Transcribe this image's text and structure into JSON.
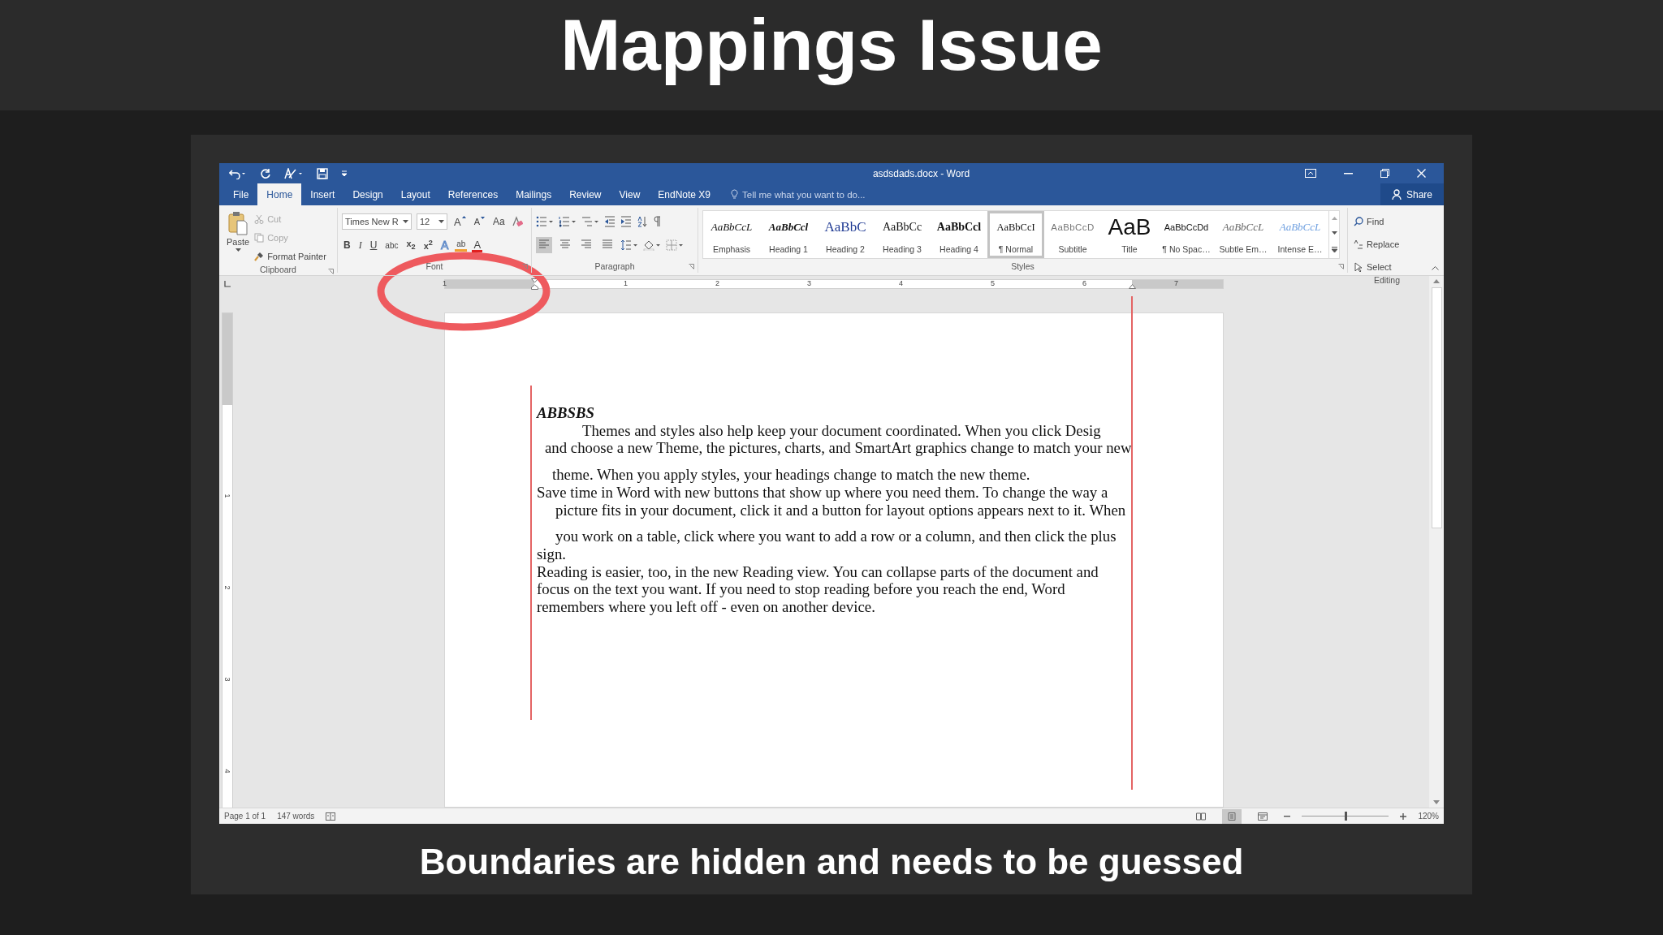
{
  "slide": {
    "title": "Mappings Issue",
    "caption": "Boundaries are hidden and needs to be guessed"
  },
  "window": {
    "title": "asdsdads.docx - Word"
  },
  "tabs": [
    {
      "label": "File",
      "selected": false
    },
    {
      "label": "Home",
      "selected": true
    },
    {
      "label": "Insert",
      "selected": false
    },
    {
      "label": "Design",
      "selected": false
    },
    {
      "label": "Layout",
      "selected": false
    },
    {
      "label": "References",
      "selected": false
    },
    {
      "label": "Mailings",
      "selected": false
    },
    {
      "label": "Review",
      "selected": false
    },
    {
      "label": "View",
      "selected": false
    },
    {
      "label": "EndNote X9",
      "selected": false
    }
  ],
  "tell_me": {
    "placeholder": "Tell me what you want to do..."
  },
  "share": "Share",
  "clipboard": {
    "label": "Clipboard",
    "paste": "Paste",
    "items": [
      {
        "label": "Cut",
        "kind": "cut"
      },
      {
        "label": "Copy",
        "kind": "copy"
      },
      {
        "label": "Format Painter",
        "kind": "painter"
      }
    ]
  },
  "font": {
    "label": "Font",
    "name": "Times New R",
    "size": "12",
    "grow": "A",
    "shrink": "A",
    "case": "Aa",
    "buttons": [
      {
        "label": "B",
        "kind": "bold"
      },
      {
        "label": "I",
        "kind": "italic"
      },
      {
        "label": "U",
        "kind": "underline"
      },
      {
        "label": "abc",
        "kind": "strike"
      },
      {
        "label": "x$_{2}$",
        "kind": "sub"
      },
      {
        "label": "x$^{2}$",
        "kind": "sup"
      }
    ],
    "effects": [
      {
        "label": "A",
        "kind": "effects"
      },
      {
        "label": "ab",
        "kind": "highlight"
      },
      {
        "label": "A",
        "kind": "color"
      }
    ]
  },
  "paragraph": {
    "label": "Paragraph",
    "align": [
      {
        "selected": true
      },
      {
        "selected": false
      },
      {
        "selected": false
      },
      {
        "selected": false
      }
    ]
  },
  "styles": {
    "label": "Styles",
    "items": [
      {
        "preview": "AaBbCcL",
        "name": "Emphasis",
        "kind": "emphasis",
        "selected": false
      },
      {
        "preview": "AaBbCcl",
        "name": "Heading 1",
        "kind": "h1",
        "selected": false
      },
      {
        "preview": "AaBbC",
        "name": "Heading 2",
        "kind": "h2",
        "selected": false
      },
      {
        "preview": "AaBbCc",
        "name": "Heading 3",
        "kind": "h3",
        "selected": false
      },
      {
        "preview": "AaBbCcl",
        "name": "Heading 4",
        "kind": "h4",
        "selected": false
      },
      {
        "preview": "AaBbCcI",
        "name": "¶ Normal",
        "kind": "normal",
        "selected": true
      },
      {
        "preview": "AaBbCcD",
        "name": "Subtitle",
        "kind": "subtitle",
        "selected": false
      },
      {
        "preview": "AaB",
        "name": "Title",
        "kind": "title",
        "selected": false
      },
      {
        "preview": "AaBbCcDd",
        "name": "¶ No Spac…",
        "kind": "nospacing",
        "selected": false
      },
      {
        "preview": "AaBbCcL",
        "name": "Subtle Em…",
        "kind": "subtle",
        "selected": false
      },
      {
        "preview": "AaBbCcL",
        "name": "Intense E…",
        "kind": "intense",
        "selected": false
      }
    ]
  },
  "editing": {
    "label": "Editing",
    "items": [
      {
        "label": "Find",
        "kind": "find"
      },
      {
        "label": "Replace",
        "kind": "replace"
      },
      {
        "label": "Select",
        "kind": "select"
      }
    ]
  },
  "ruler": {
    "labels": [
      "1",
      "1",
      "2",
      "3",
      "4",
      "5",
      "6",
      "7"
    ]
  },
  "vertical_ruler": {
    "labels": [
      "1",
      "2",
      "3",
      "4"
    ]
  },
  "document": {
    "lines": [
      {
        "text": "ABBSBS",
        "kind": "title"
      },
      {
        "text": "Themes and styles also help keep your document coordinated. When you click Desig",
        "kind": "first"
      },
      {
        "text": "and choose a new Theme, the pictures, charts, and SmartArt graphics change to match your new",
        "kind": "small"
      },
      {
        "text": "theme. When you apply styles, your headings change to match the new theme.",
        "kind": "mid",
        "gap_before": true
      },
      {
        "text": "Save time in Word with new buttons that show up where you need them. To change the way a",
        "kind": "plain"
      },
      {
        "text": "picture fits in your document, click it and a button for layout options appears next to it. When",
        "kind": "wide"
      },
      {
        "text": "you work on a table, click where you want to add a row or a column, and then click the plus",
        "kind": "wide",
        "gap_before": true
      },
      {
        "text": "sign.",
        "kind": "plain"
      },
      {
        "text": "Reading is easier, too, in the new Reading view. You can collapse parts of the document and",
        "kind": "plain"
      },
      {
        "text": "focus on the text you want. If you need to stop reading before you reach the end, Word",
        "kind": "plain"
      },
      {
        "text": "remembers where you left off - even on another device.",
        "kind": "plain"
      }
    ]
  },
  "status_bar": {
    "page": "Page 1 of 1",
    "words": "147 words",
    "zoom": "120%",
    "zoom_slider": {
      "level": 0.5
    },
    "views": [
      {
        "selected": false
      },
      {
        "selected": true
      },
      {
        "selected": false
      }
    ]
  }
}
